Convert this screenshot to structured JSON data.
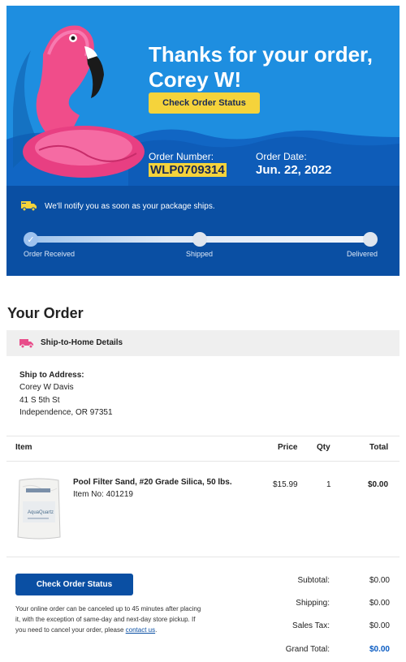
{
  "hero": {
    "title": "Thanks for your order, Corey W!",
    "check_status_label": "Check Order Status",
    "order_number_label": "Order Number:",
    "order_number": "WLP0709314",
    "order_date_label": "Order Date:",
    "order_date": "Jun. 22, 2022"
  },
  "tracker": {
    "notify_text": "We'll notify you as soon as your package ships.",
    "progress_percent": 0,
    "steps": [
      "Order Received",
      "Shipped",
      "Delivered"
    ]
  },
  "order": {
    "heading": "Your Order",
    "ship_header": "Ship-to-Home Details",
    "ship_to_label": "Ship to Address:",
    "address": [
      "Corey W Davis",
      "41 S 5th St",
      "Independence, OR 97351"
    ],
    "columns": {
      "item": "Item",
      "price": "Price",
      "qty": "Qty",
      "total": "Total"
    },
    "product": {
      "name": "Pool Filter Sand, #20 Grade Silica, 50 lbs.",
      "item_no": "Item No: 401219",
      "price": "$15.99",
      "qty": "1",
      "total": "$0.00"
    },
    "check_status_label": "Check Order Status",
    "cancel_note": "Your online order can be canceled up to 45 minutes after placing it, with the exception of same-day and next-day store pickup. If you need to cancel your order, please",
    "contact_link": "contact us",
    "summary": {
      "subtotal_label": "Subtotal:",
      "subtotal": "$0.00",
      "shipping_label": "Shipping:",
      "shipping": "$0.00",
      "tax_label": "Sales Tax:",
      "tax": "$0.00",
      "grand_label": "Grand Total:",
      "grand": "$0.00"
    }
  },
  "colors": {
    "hero_blue": "#1e8ee0",
    "tracker_blue": "#0a4fa3",
    "accent_yellow": "#f5d33b",
    "flamingo_pink": "#f04d8a"
  },
  "icons": {
    "truck": "truck-icon",
    "ship_home": "ship-to-home-truck-icon",
    "check": "checkmark-icon"
  }
}
